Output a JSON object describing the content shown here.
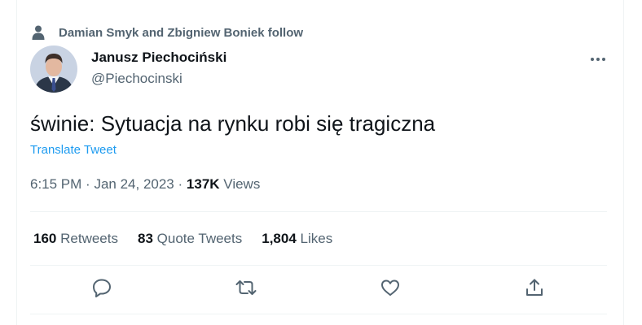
{
  "social_context": {
    "text": "Damian Smyk and Zbigniew Boniek follow",
    "icon": "person-icon"
  },
  "author": {
    "name": "Janusz Piechociński",
    "handle": "@Piechocinski",
    "avatar": "profile-photo"
  },
  "tweet": {
    "text": "świnie: Sytuacja na rynku robi się tragiczna",
    "translate_label": "Translate Tweet"
  },
  "meta": {
    "time": "6:15 PM",
    "separator": "·",
    "date": "Jan 24, 2023",
    "views_count": "137K",
    "views_label": "Views"
  },
  "stats": {
    "retweets": {
      "count": "160",
      "label": "Retweets"
    },
    "quotes": {
      "count": "83",
      "label": "Quote Tweets"
    },
    "likes": {
      "count": "1,804",
      "label": "Likes"
    }
  },
  "actions": {
    "reply": "reply-icon",
    "retweet": "retweet-icon",
    "like": "heart-icon",
    "share": "share-icon",
    "more": "more-icon"
  },
  "colors": {
    "text": "#0f1419",
    "secondary": "#536471",
    "link": "#1d9bf0",
    "divider": "#eff3f4"
  }
}
